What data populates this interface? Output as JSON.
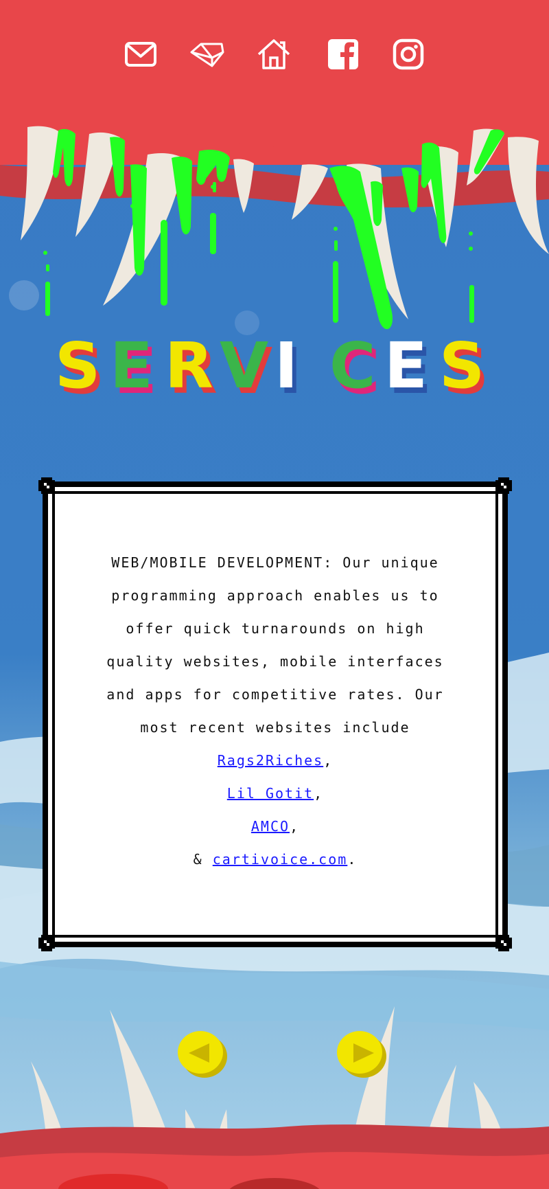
{
  "nav": {
    "icons": [
      {
        "name": "mail-icon"
      },
      {
        "name": "logo-diamond-icon"
      },
      {
        "name": "home-icon"
      },
      {
        "name": "facebook-icon"
      },
      {
        "name": "instagram-icon"
      }
    ]
  },
  "header": {
    "title": "SERVICES"
  },
  "card": {
    "lines": [
      "WEB/MOBILE DEVELOPMENT: Our unique",
      "programming approach enables us to",
      "offer quick turnarounds on high",
      "quality websites, mobile interfaces",
      "and apps for competitive rates. Our",
      "most recent websites include"
    ],
    "links": [
      {
        "label": "Rags2Riches",
        "suffix": ","
      },
      {
        "label": "Lil Gotit",
        "suffix": ","
      },
      {
        "label": "AMCO",
        "suffix": ","
      }
    ],
    "last_prefix": "& ",
    "last_link": "cartivoice.com",
    "last_suffix": "."
  },
  "colors": {
    "top_red": "#e8464a",
    "sky_blue": "#3a7ec4",
    "slime_green": "#22ff22",
    "tooth": "#efe9df",
    "arrow_yellow": "#f2e600",
    "link_blue": "#1a1aff"
  }
}
